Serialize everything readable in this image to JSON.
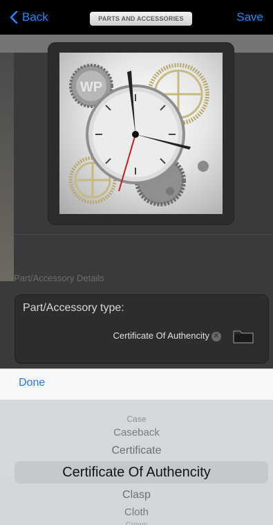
{
  "nav": {
    "back_label": "Back",
    "title": "PARTS AND ACCESSORIES",
    "save_label": "Save"
  },
  "details": {
    "section_header": "Part/Accessory Details",
    "type_label": "Part/Accessory type:",
    "type_value": "Certificate Of Authencity"
  },
  "picker": {
    "done_label": "Done",
    "items": [
      "Case",
      "Caseback",
      "Certificate",
      "Certificate Of Authencity",
      "Clasp",
      "Cloth",
      "Crown"
    ],
    "selected_index": 3
  },
  "icons": {
    "back": "chevron-left-icon",
    "clear": "clear-circle-icon",
    "folder": "folder-icon"
  },
  "colors": {
    "accent": "#1f8bff",
    "nav_bg": "#000000",
    "picker_bg": "#d4d8dc"
  }
}
